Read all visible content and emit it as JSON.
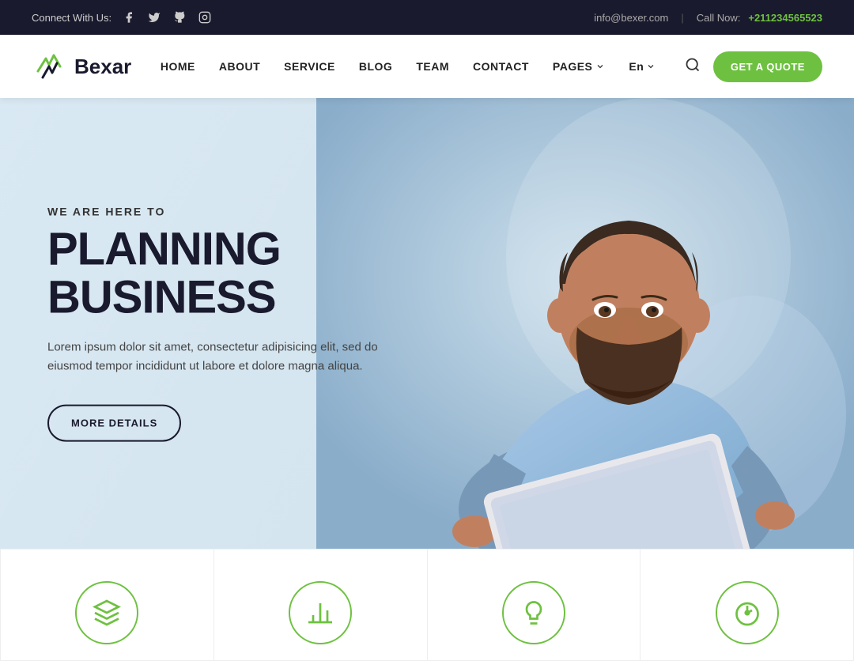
{
  "topbar": {
    "connect_label": "Connect With Us:",
    "email": "info@bexer.com",
    "call_label": "Call Now:",
    "phone": "+211234565523",
    "social_icons": [
      "facebook",
      "twitter",
      "github",
      "instagram"
    ]
  },
  "navbar": {
    "logo_text": "Bexar",
    "nav_links": [
      {
        "label": "HOME",
        "has_dropdown": false
      },
      {
        "label": "ABOUT",
        "has_dropdown": false
      },
      {
        "label": "SERVICE",
        "has_dropdown": false
      },
      {
        "label": "BLOG",
        "has_dropdown": false
      },
      {
        "label": "TEAM",
        "has_dropdown": false
      },
      {
        "label": "CONTACT",
        "has_dropdown": false
      },
      {
        "label": "PAGES",
        "has_dropdown": true
      },
      {
        "label": "En",
        "has_dropdown": true
      }
    ],
    "quote_button": "GET A QUOTE"
  },
  "hero": {
    "subtitle": "WE ARE HERE TO",
    "title": "PLANNING BUSINESS",
    "description": "Lorem ipsum dolor sit amet, consectetur adipisicing elit, sed do eiusmod tempor incididunt ut labore et dolore magna aliqua.",
    "button_label": "MORE DETAILS"
  },
  "features": [
    {
      "icon": "diamond",
      "unicode": "◆"
    },
    {
      "icon": "bar-chart",
      "unicode": "▮"
    },
    {
      "icon": "lightbulb",
      "unicode": "💡"
    },
    {
      "icon": "speedometer",
      "unicode": "⊙"
    }
  ],
  "colors": {
    "accent": "#6ec140",
    "dark": "#1a1a2e",
    "topbar_bg": "#1a1a2e"
  }
}
